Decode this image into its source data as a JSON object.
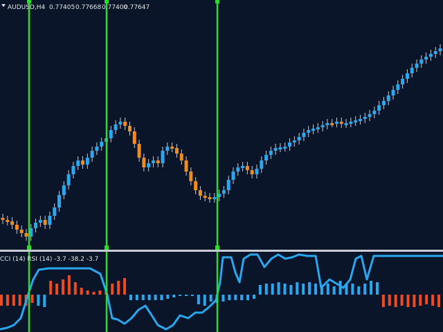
{
  "main_chart": {
    "symbol_timeframe": "AUDUSD,H4",
    "ohlc": [
      "0.77405",
      "0.77668",
      "0.77400",
      "0.77647"
    ],
    "colors": {
      "bull": "#29a8f0",
      "bear": "#f08c1e",
      "background": "#0b1529",
      "marker": "#25e025"
    }
  },
  "indicator": {
    "label": "CCI (14) RSI (14) -3.7 -38.2 -3.7",
    "colors": {
      "line": "#29a8f0",
      "bar_pos": "#29a8f0",
      "bar_neg": "#f04a1e"
    }
  }
}
